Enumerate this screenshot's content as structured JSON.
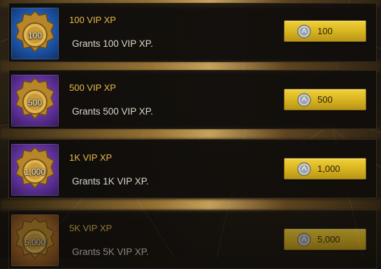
{
  "shop_items": [
    {
      "badge": "100",
      "title": "100 VIP XP",
      "description": "Grants 100 VIP XP.",
      "price": "100",
      "rarity": "blue",
      "rarity_color": "#1a4f9e"
    },
    {
      "badge": "500",
      "title": "500 VIP XP",
      "description": "Grants 500 VIP XP.",
      "price": "500",
      "rarity": "purple",
      "rarity_color": "#5b2f93"
    },
    {
      "badge": "1,000",
      "title": "1K VIP XP",
      "description": "Grants 1K VIP XP.",
      "price": "1,000",
      "rarity": "purple",
      "rarity_color": "#5b2f93"
    },
    {
      "badge": "5,000",
      "title": "5K VIP XP",
      "description": "Grants 5K VIP XP.",
      "price": "5,000",
      "rarity": "orange",
      "rarity_color": "#9a5d22"
    }
  ],
  "currency": {
    "icon": "silver-coin-icon"
  },
  "colors": {
    "title": "#e7b94c",
    "button": "#d6b21f",
    "background": "#14110d"
  }
}
